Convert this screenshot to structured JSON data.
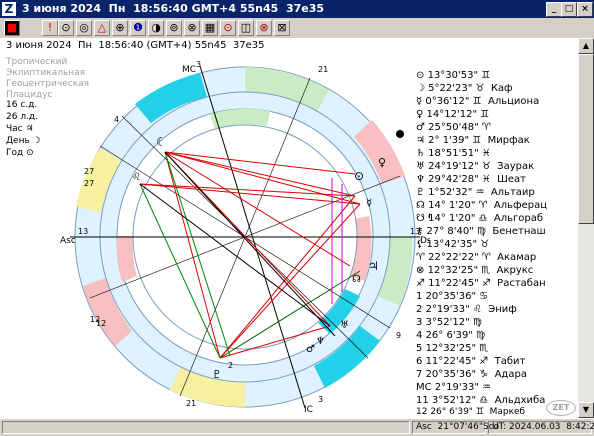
{
  "window": {
    "title": "3 июня 2024  Пн  18:56:40 GMT+4 55n45  37e35",
    "logo": "Z",
    "btn_min": "_",
    "btn_max": "□",
    "btn_close": "×"
  },
  "toolbar": [
    "■",
    "!",
    "⊙",
    "◎",
    "△",
    "⊕",
    "❶",
    "◑",
    "⊚",
    "⊗",
    "▦",
    "⊙",
    "◫",
    "⊗",
    "⊠"
  ],
  "header": {
    "info": "3 июня 2024  Пн  18:56:40 (GMT+4) 55n45  37e35"
  },
  "side": {
    "l1": "Тропический",
    "l2": "Эклиптикальная",
    "l3": "Геоцентрическая",
    "l4": "Плацидус",
    "l5": "16 с.д.",
    "l6": "26 л.д.",
    "l7": "Час ♃",
    "l8": "День ☽",
    "l9": "Год ⊙"
  },
  "planets": [
    {
      "sym": "⊙",
      "text": "13°30'53\" ♊"
    },
    {
      "sym": "☽",
      "text": "5°22'23\" ♉  Каф"
    },
    {
      "sym": "☿",
      "text": "0°36'12\" ♊  Альциона"
    },
    {
      "sym": "♀",
      "text": "14°12'12\" ♊"
    },
    {
      "sym": "♂",
      "text": "25°50'48\" ♈"
    },
    {
      "sym": "♃",
      "text": "2° 1'39\" ♊  Мирфак"
    },
    {
      "sym": "♄",
      "text": "18°51'51\" ♓"
    },
    {
      "sym": "♅",
      "text": "24°19'12\" ♉  Заурак"
    },
    {
      "sym": "♆",
      "text": "29°42'28\" ♓  Шеат"
    },
    {
      "sym": "♇",
      "text": "1°52'32\" ♒  Альтаир"
    },
    {
      "sym": "☊",
      "text": "14° 1'20\" ♈  Альферац"
    },
    {
      "sym": "☋",
      "text": "14° 1'20\" ♎  Альгораб"
    },
    {
      "sym": "⚷",
      "text": "27° 8'40\" ♍  Бенетнаш"
    },
    {
      "sym": "⚸",
      "text": "13°42'35\" ♉"
    },
    {
      "sym": "♈",
      "text": "22°22'22\" ♈  Акамар"
    },
    {
      "sym": "⊗",
      "text": "12°32'25\" ♏  Акрукс"
    },
    {
      "sym": "♐",
      "text": "11°22'45\" ♐  Растабан"
    },
    {
      "sym": "1",
      "text": "20°35'36\" ♋"
    },
    {
      "sym": "2",
      "text": "2°19'33\" ♌  Эниф"
    },
    {
      "sym": "3",
      "text": "3°52'12\" ♍"
    },
    {
      "sym": "4",
      "text": "26° 6'39\" ♍"
    },
    {
      "sym": "5",
      "text": "12°32'25\" ♏"
    },
    {
      "sym": "6",
      "text": "11°22'45\" ♐  Табит"
    },
    {
      "sym": "7",
      "text": "20°35'36\" ♑  Адара"
    },
    {
      "sym": "MC",
      "text": "2°19'33\" ♒"
    },
    {
      "sym": "11",
      "text": "3°52'12\" ♎  Альдхиба"
    },
    {
      "sym": "12",
      "text": "26° 6'39\" ♊  Маркеб"
    }
  ],
  "chart_labels": {
    "asc": "Asc",
    "dsc": "Dsc",
    "mc": "MC",
    "ic": "IC",
    "asc_num": "13",
    "dsc_num": "13",
    "mc_num": "3",
    "ic_num": "3",
    "h9": "21",
    "h3": "21",
    "h11": "4",
    "h12": "27",
    "h2": "12",
    "h5": "9",
    "h6": "2",
    "h8": "27",
    "h4": "12"
  },
  "status": {
    "asc": "Asc  21°07'46\"Sco",
    "ut": "UT: 2024.06.03  8:42:20",
    "zet": "ZET"
  }
}
